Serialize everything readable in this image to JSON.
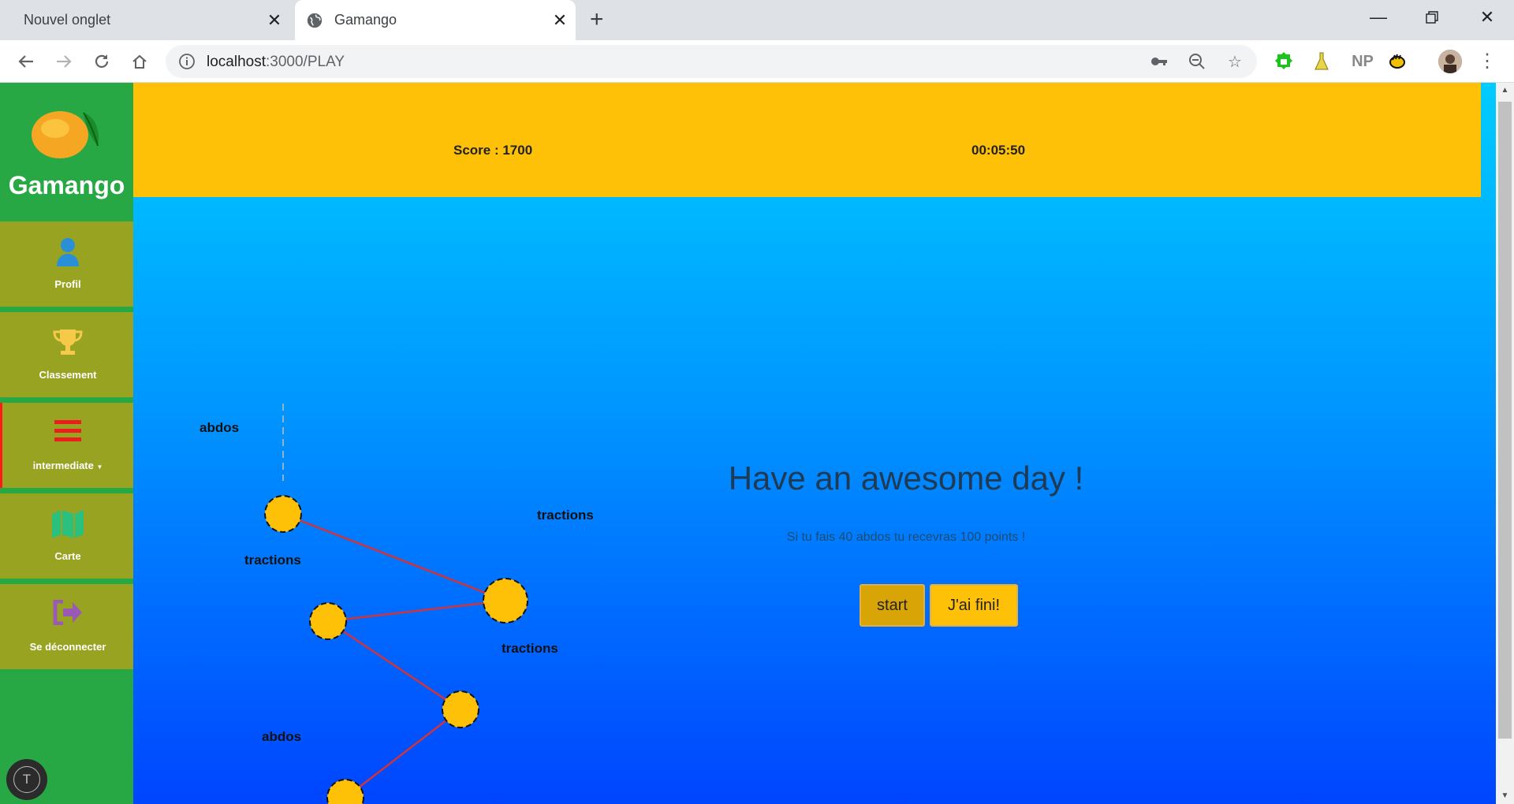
{
  "browser": {
    "tabs": [
      {
        "title": "Nouvel onglet",
        "active": false
      },
      {
        "title": "Gamango",
        "active": true
      }
    ],
    "new_tab_label": "+",
    "url_host": "localhost",
    "url_path": ":3000/PLAY",
    "icons": [
      "back-icon",
      "forward-icon",
      "reload-icon",
      "home-icon",
      "info-icon",
      "key-icon",
      "zoom-out-icon",
      "star-icon"
    ],
    "extensions": [
      {
        "name": "green-extension-icon",
        "color": "#1ec31e"
      },
      {
        "name": "flask-extension-icon",
        "color": "#b89a00"
      },
      {
        "name": "np-extension-icon",
        "label": "NP",
        "color": "#888888"
      },
      {
        "name": "hand-extension-icon",
        "color": "#111111"
      }
    ]
  },
  "sidebar": {
    "brand": "Gamango",
    "items": [
      {
        "label": "Profil",
        "icon": "user-icon",
        "icon_color": "#2b8fd6"
      },
      {
        "label": "Classement",
        "icon": "trophy-icon",
        "icon_color": "#f7c948"
      },
      {
        "label": "intermediate",
        "icon": "hamburger-icon",
        "icon_color": "#ee1c1c",
        "has_dropdown": true
      },
      {
        "label": "Carte",
        "icon": "map-icon",
        "icon_color": "#2cc07e"
      },
      {
        "label": "Se déconnecter",
        "icon": "sign-out-icon",
        "icon_color": "#9b59b6"
      }
    ]
  },
  "header": {
    "score": "Score : 1700",
    "timer": "00:05:50"
  },
  "path": {
    "nodes": [
      {
        "label": "abdos"
      },
      {
        "label": "tractions"
      },
      {
        "label": "tractions"
      },
      {
        "label": "tractions"
      },
      {
        "label": "abdos"
      }
    ],
    "node_color": "#ffc107",
    "line_color": "#d0343a"
  },
  "main": {
    "greeting": "Have an awesome day !",
    "subtitle": "Si tu fais 40 abdos tu recevras 100 points !",
    "start_label": "start",
    "done_label": "J'ai fini!"
  },
  "floating_button": {
    "label": "T"
  }
}
